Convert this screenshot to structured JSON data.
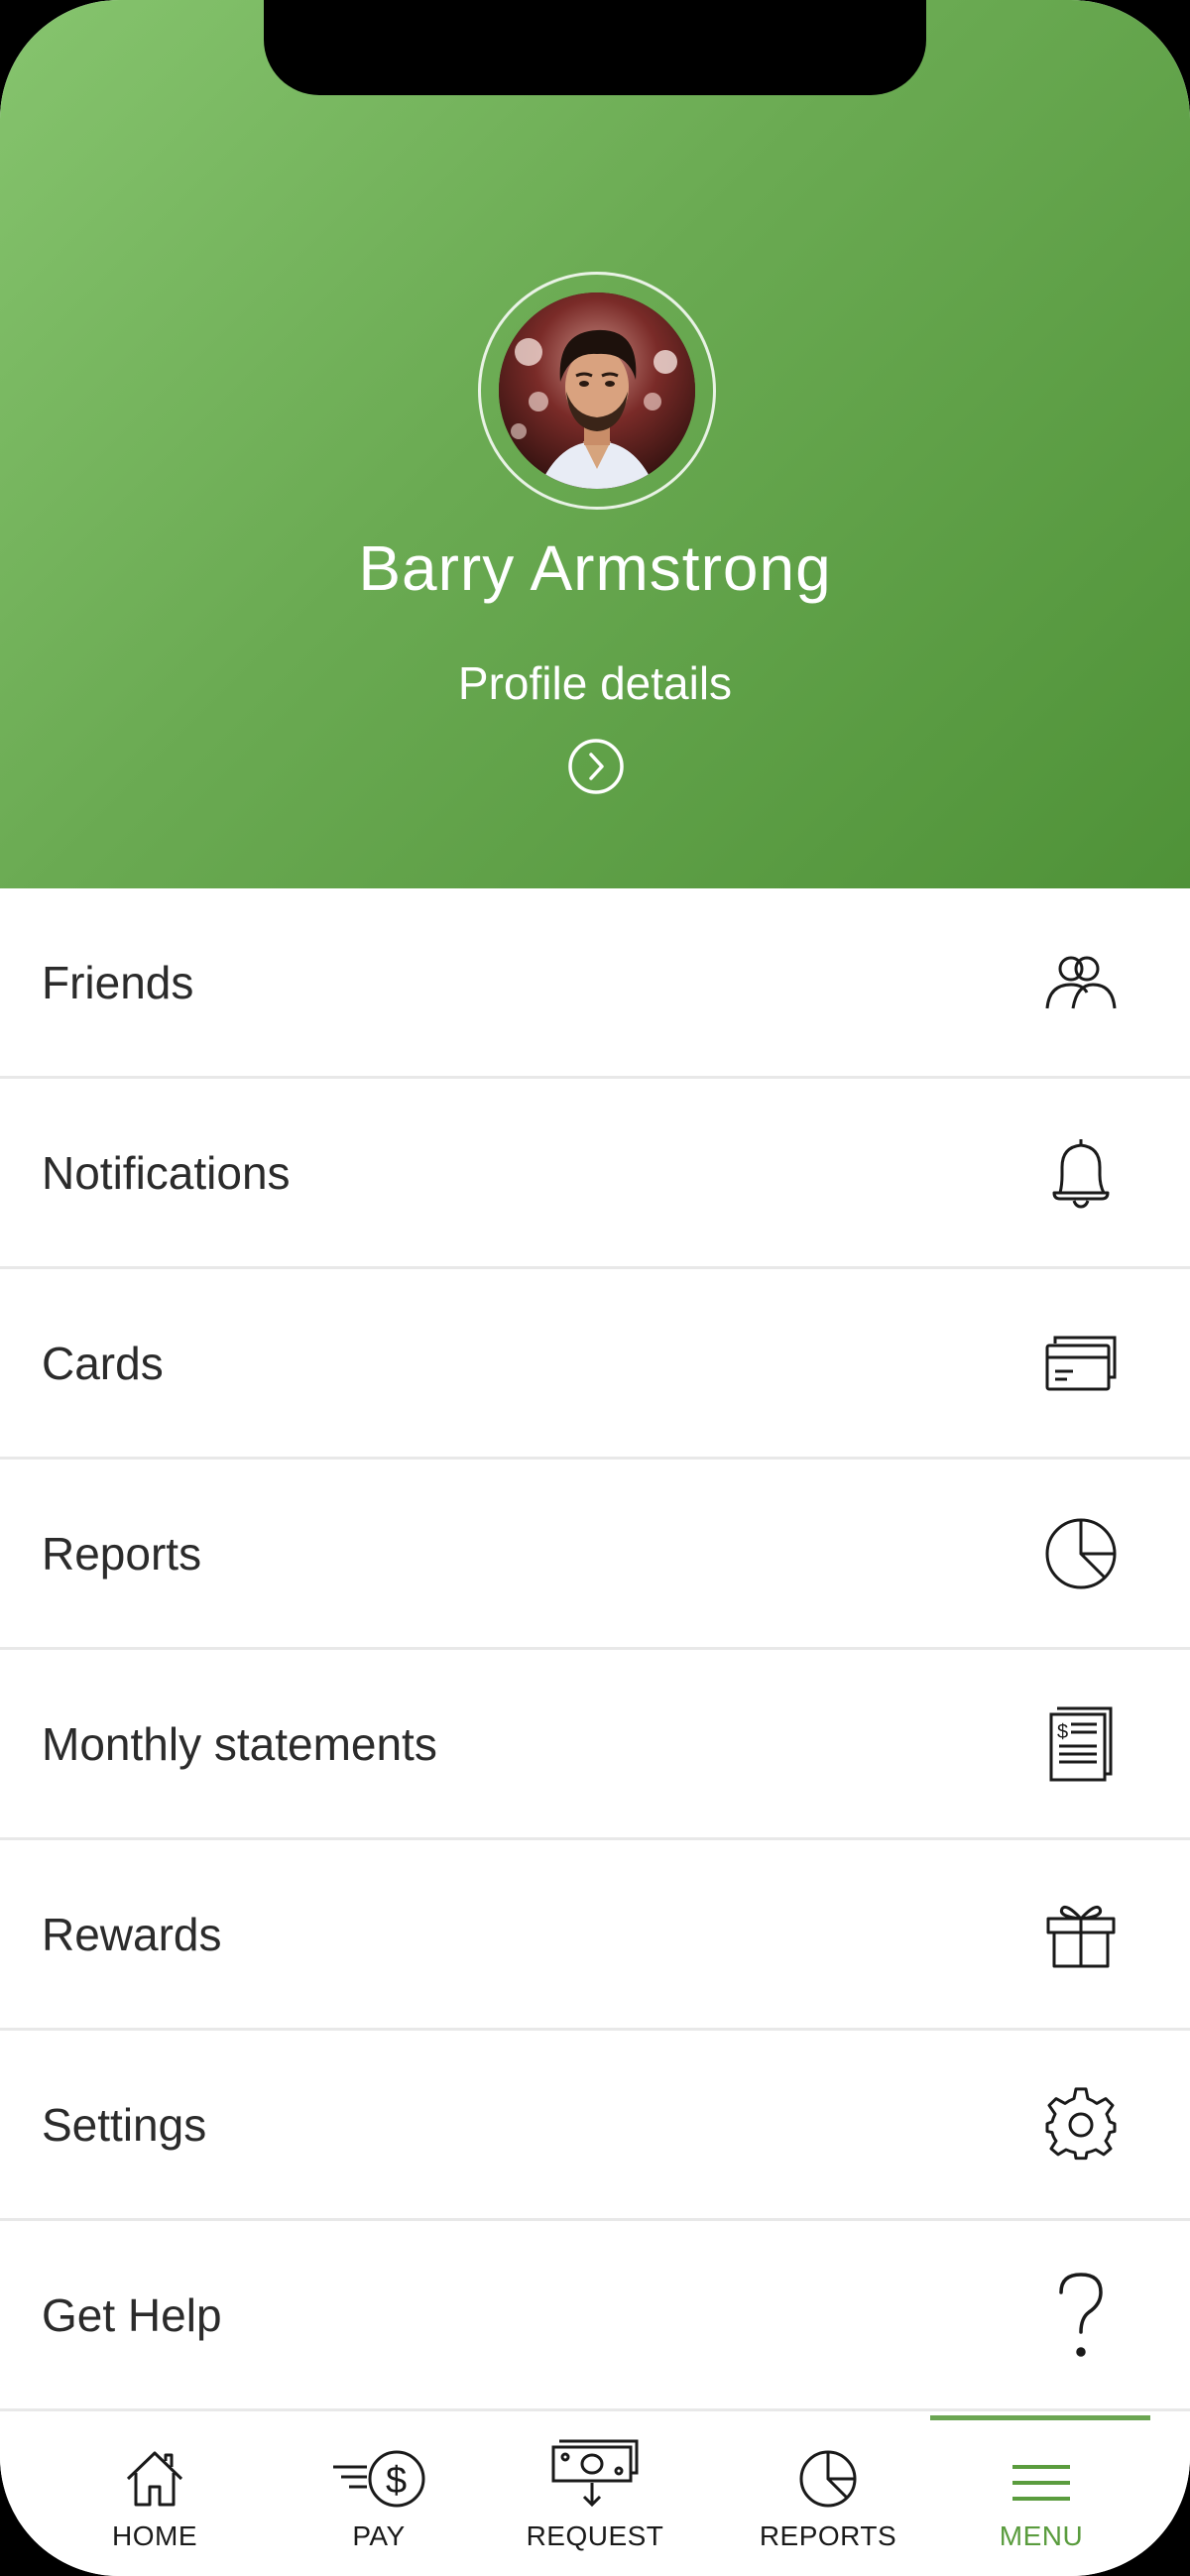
{
  "profile": {
    "name": "Barry Armstrong",
    "details_label": "Profile details"
  },
  "colors": {
    "header_gradient_start": "#86c46e",
    "header_gradient_end": "#4f9238",
    "accent": "#5a9c3e",
    "text": "#2b2b2b"
  },
  "menu": {
    "items": [
      {
        "label": "Friends",
        "icon": "friends-icon"
      },
      {
        "label": "Notifications",
        "icon": "bell-icon"
      },
      {
        "label": "Cards",
        "icon": "cards-icon"
      },
      {
        "label": "Reports",
        "icon": "pie-chart-icon"
      },
      {
        "label": "Monthly statements",
        "icon": "statement-icon"
      },
      {
        "label": "Rewards",
        "icon": "gift-icon"
      },
      {
        "label": "Settings",
        "icon": "gear-icon"
      },
      {
        "label": "Get Help",
        "icon": "question-icon"
      }
    ]
  },
  "tabbar": {
    "tabs": [
      {
        "label": "HOME",
        "icon": "home-icon"
      },
      {
        "label": "PAY",
        "icon": "pay-icon"
      },
      {
        "label": "REQUEST",
        "icon": "request-icon"
      },
      {
        "label": "REPORTS",
        "icon": "reports-icon"
      },
      {
        "label": "MENU",
        "icon": "menu-icon"
      }
    ],
    "active": "MENU"
  }
}
